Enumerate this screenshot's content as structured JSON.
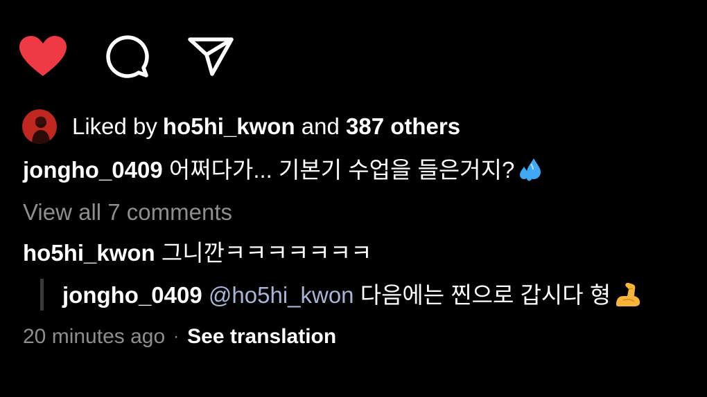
{
  "actions": {
    "like_icon": "heart-filled-icon",
    "comment_icon": "comment-bubble-icon",
    "share_icon": "paper-plane-icon",
    "like_color": "#ed3a45"
  },
  "likes": {
    "prefix": "Liked by ",
    "liker": "ho5hi_kwon",
    "middle": " and ",
    "count_text": "387 others"
  },
  "caption": {
    "username": "jongho_0409",
    "text": " 어쩌다가... 기본기 수업을 들은거지?",
    "emoji": "sweat-droplets-emoji"
  },
  "comments": {
    "view_all": "View all 7 comments"
  },
  "reply1": {
    "username": "ho5hi_kwon",
    "text": " 그니깐ㅋㅋㅋㅋㅋㅋㅋ"
  },
  "reply2": {
    "username": "jongho_0409",
    "mention": "@ho5hi_kwon",
    "text": " 다음에는 찐으로 갑시다 형",
    "emoji": "flexed-biceps-emoji"
  },
  "meta": {
    "time": "20 minutes ago",
    "separator": "·",
    "translation": "See translation"
  }
}
